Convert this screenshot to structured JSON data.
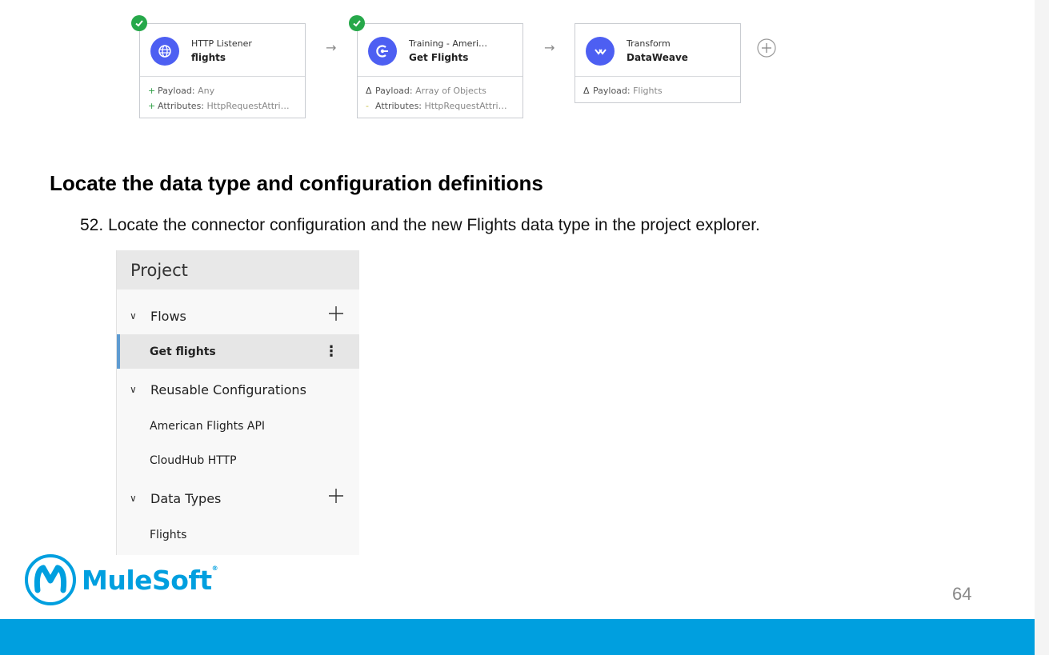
{
  "flow": {
    "cards": [
      {
        "title": "HTTP Listener",
        "subtitle": "flights",
        "icon": "globe-icon",
        "meta": [
          {
            "marker": "+",
            "label": "Payload:",
            "value": "Any"
          },
          {
            "marker": "+",
            "label": "Attributes:",
            "value": "HttpRequestAttri…"
          }
        ]
      },
      {
        "title": "Training - Ameri…",
        "subtitle": "Get Flights",
        "icon": "connector-icon",
        "meta": [
          {
            "marker": "Δ",
            "label": "Payload:",
            "value": "Array of Objects"
          },
          {
            "marker": "-",
            "label": "Attributes:",
            "value": "HttpRequestAttri…"
          }
        ]
      },
      {
        "title": "Transform",
        "subtitle": "DataWeave",
        "icon": "dataweave-icon",
        "meta": [
          {
            "marker": "Δ",
            "label": "Payload:",
            "value": "Flights"
          }
        ]
      }
    ],
    "arrow": "→"
  },
  "section_title": "Locate the data type and configuration definitions",
  "step_text": "52. Locate the connector configuration and the new Flights data type in the project explorer.",
  "project": {
    "header": "Project",
    "groups": [
      {
        "label": "Flows",
        "items": [
          "Get flights"
        ]
      },
      {
        "label": "Reusable Configurations",
        "items": [
          "American Flights API",
          "CloudHub HTTP"
        ]
      },
      {
        "label": "Data Types",
        "items": [
          "Flights"
        ]
      }
    ],
    "more_glyph": "⋮",
    "chevron": "∨"
  },
  "logo": {
    "text": "MuleSoft",
    "reg": "®"
  },
  "page_number": "64",
  "colors": {
    "brand_blue": "#009fdf",
    "node_blue": "#4d5ff2",
    "success_green": "#26a84a"
  }
}
